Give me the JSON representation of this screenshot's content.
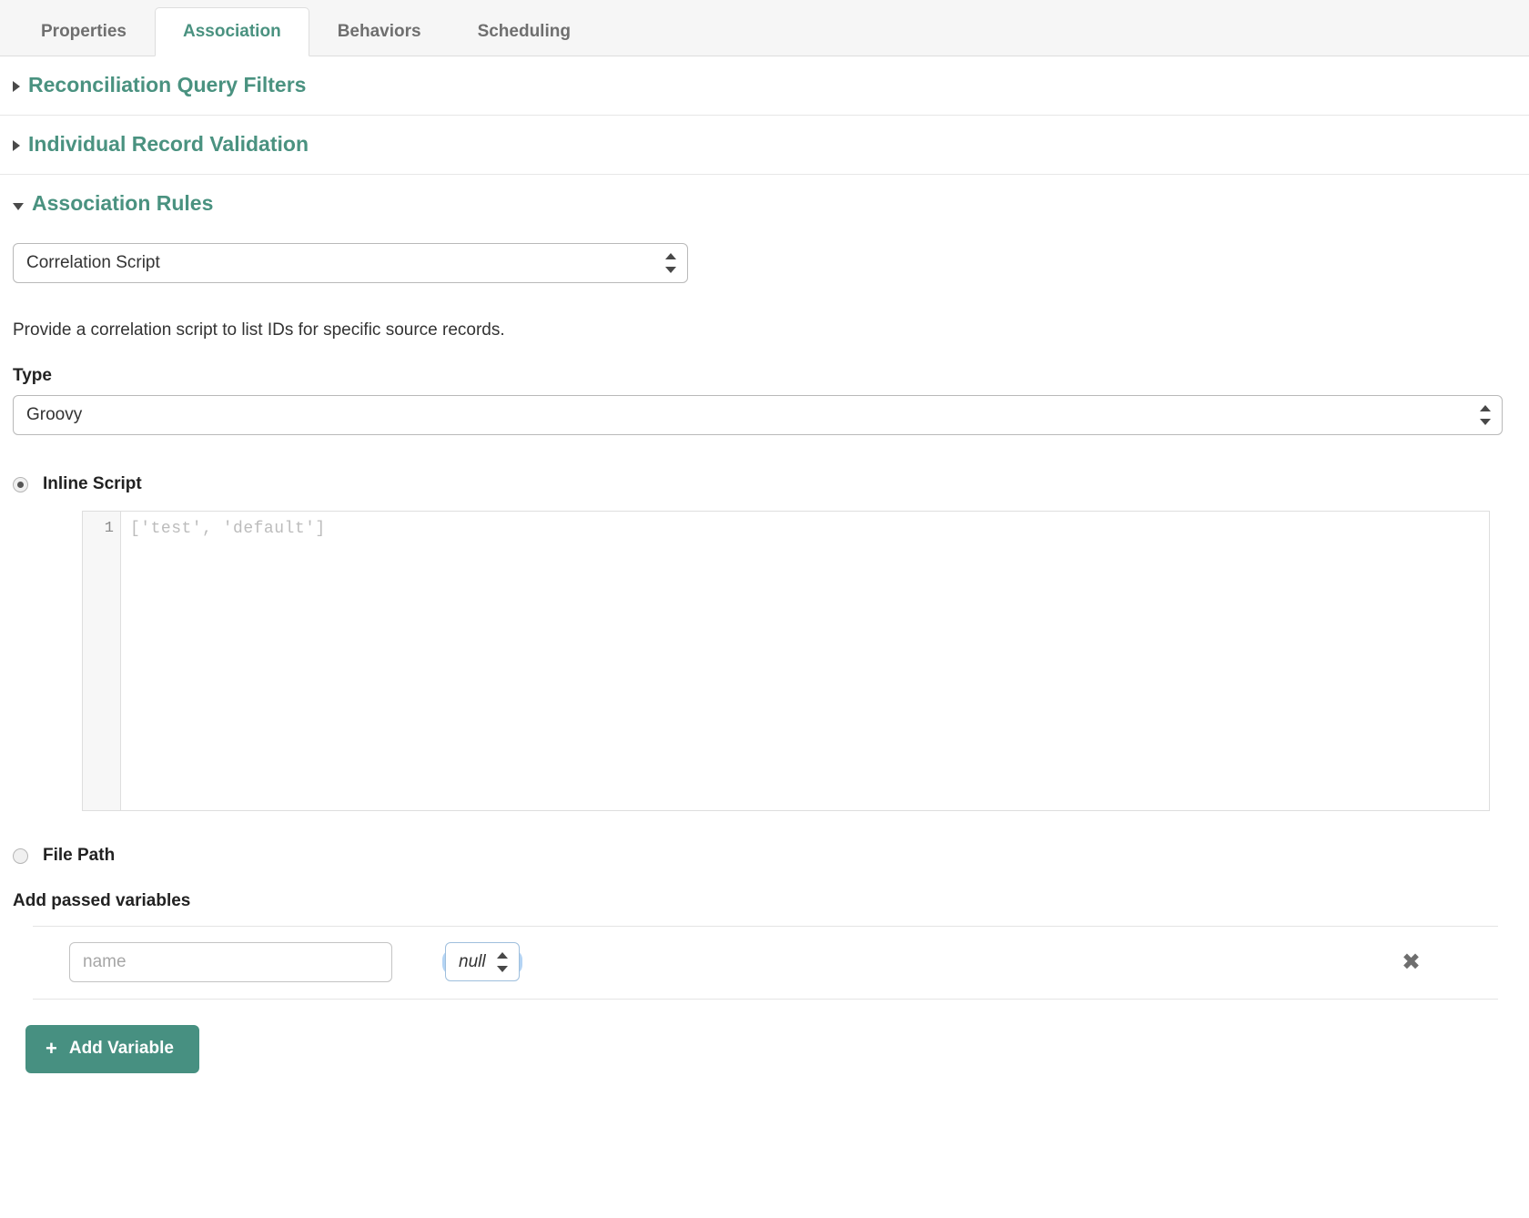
{
  "tabs": [
    {
      "label": "Properties",
      "active": false
    },
    {
      "label": "Association",
      "active": true
    },
    {
      "label": "Behaviors",
      "active": false
    },
    {
      "label": "Scheduling",
      "active": false
    }
  ],
  "sections": [
    {
      "title": "Reconciliation Query Filters",
      "expanded": false,
      "caret_icon": "caret-right-icon"
    },
    {
      "title": "Individual Record Validation",
      "expanded": false,
      "caret_icon": "caret-right-icon"
    },
    {
      "title": "Association Rules",
      "expanded": true,
      "caret_icon": "caret-down-icon"
    }
  ],
  "association_rules": {
    "rule_select": {
      "value": "Correlation Script",
      "stepper_icon": "stepper-updown-icon"
    },
    "help_text": "Provide a correlation script to list IDs for specific source records.",
    "type_label": "Type",
    "type_select": {
      "value": "Groovy",
      "stepper_icon": "stepper-updown-icon"
    },
    "inline_script": {
      "label": "Inline Script",
      "selected": true
    },
    "editor": {
      "line_number": "1",
      "placeholder_code": "['test', 'default']"
    },
    "file_path": {
      "label": "File Path",
      "selected": false
    },
    "variables": {
      "heading": "Add passed variables",
      "rows": [
        {
          "name_value": "",
          "name_placeholder": "name",
          "value_select": "null",
          "delete_icon": "close-x-icon"
        }
      ],
      "add_button": {
        "label": "Add Variable",
        "plus_icon": "plus-icon"
      }
    }
  },
  "colors": {
    "accent": "#4a9280",
    "button": "#479081",
    "tabbar_bg": "#f6f6f6",
    "focus_ring": "#58a0e6"
  }
}
